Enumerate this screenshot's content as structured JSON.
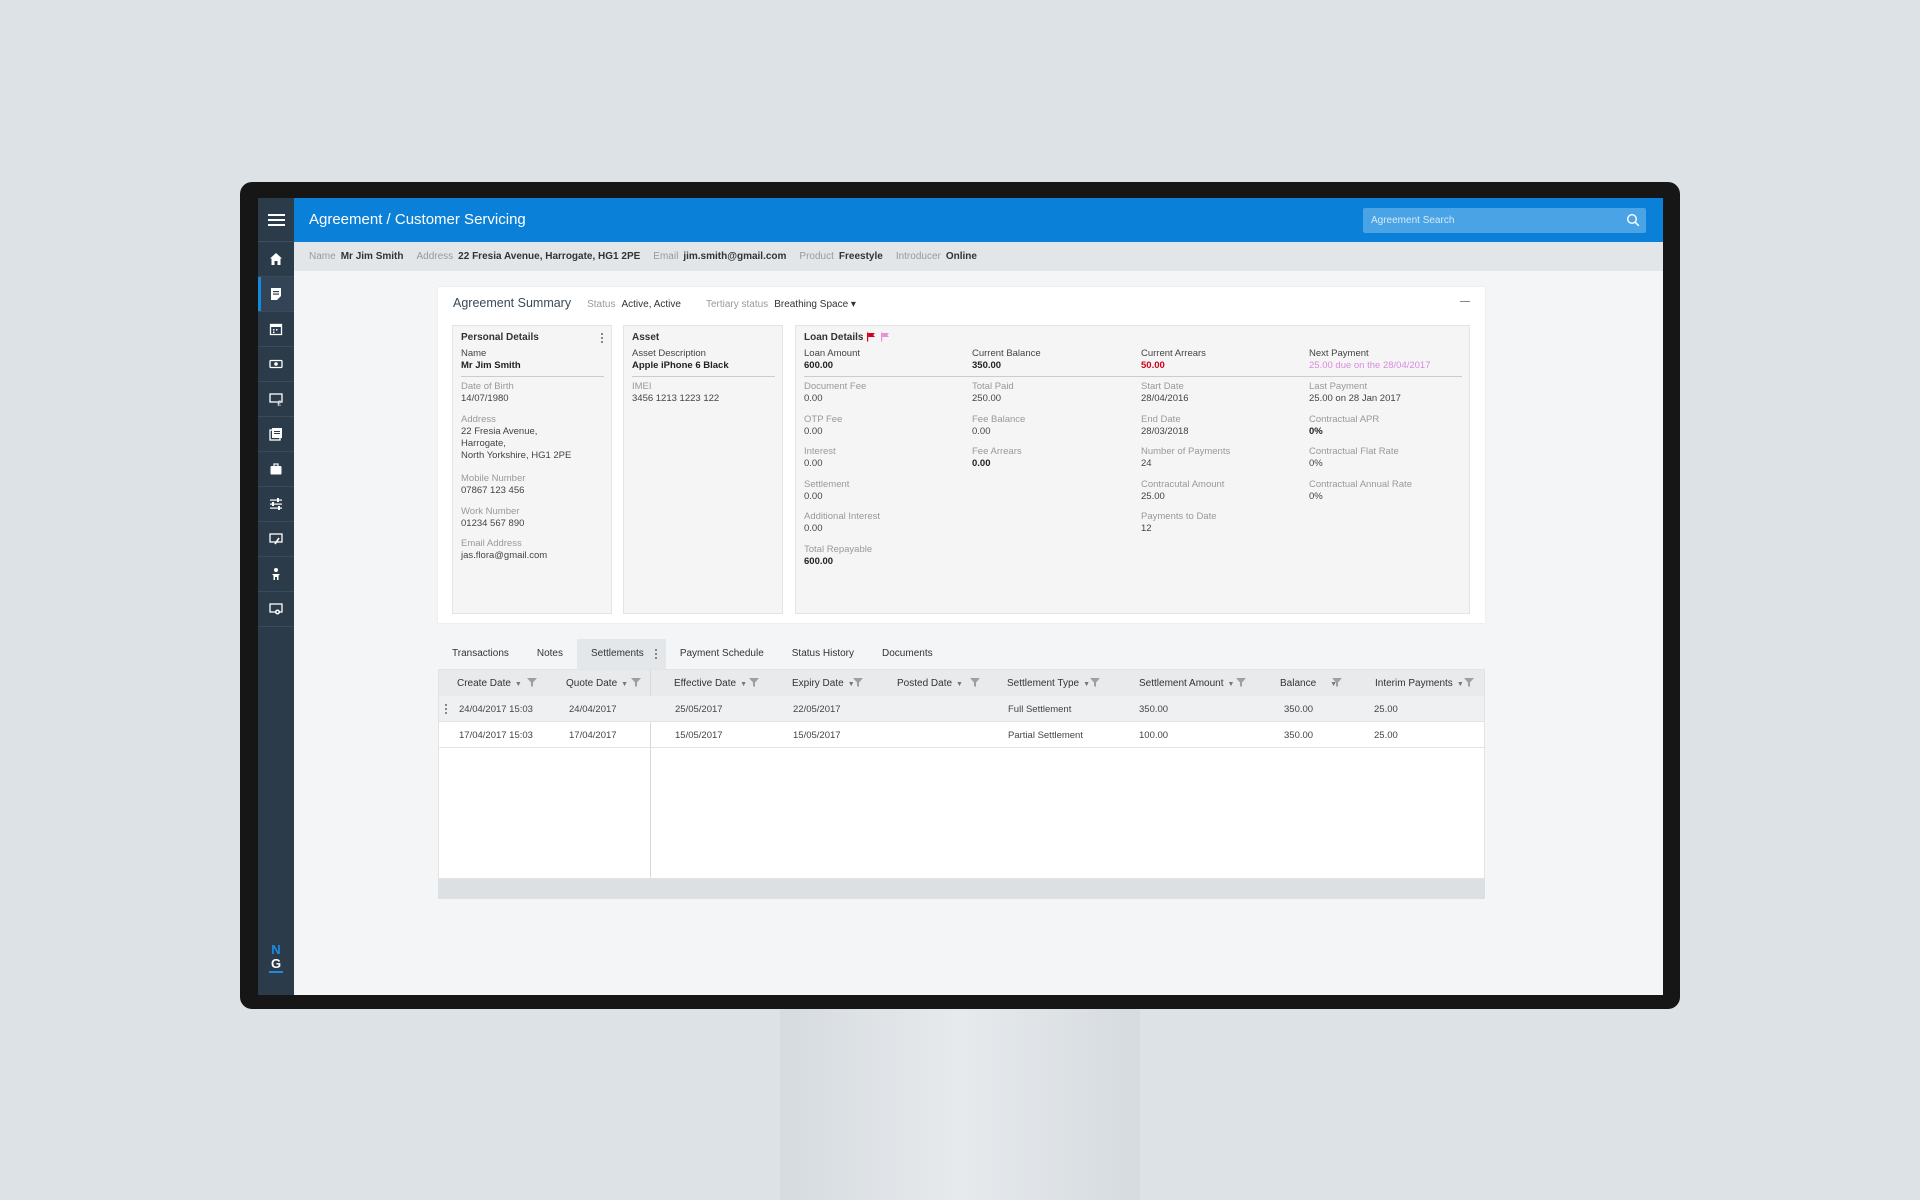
{
  "app": {
    "title": "Agreement / Customer Servicing"
  },
  "search": {
    "placeholder": "Agreement Search"
  },
  "infobar": {
    "name_label": "Name",
    "name": "Mr Jim Smith",
    "address_label": "Address",
    "address": "22 Fresia Avenue, Harrogate, HG1 2PE",
    "email_label": "Email",
    "email": "jim.smith@gmail.com",
    "product_label": "Product",
    "product": "Freestyle",
    "introducer_label": "Introducer",
    "introducer": "Online"
  },
  "summary": {
    "title": "Agreement Summary",
    "status_label": "Status",
    "status": "Active, Active",
    "tertiary_label": "Tertiary status",
    "tertiary": "Breathing Space ▾"
  },
  "personal": {
    "title": "Personal Details",
    "name_label": "Name",
    "name": "Mr Jim Smith",
    "dob_label": "Date of Birth",
    "dob": "14/07/1980",
    "address_label": "Address",
    "address1": "22 Fresia Avenue,",
    "address2": "Harrogate,",
    "address3": "North Yorkshire, HG1 2PE",
    "mobile_label": "Mobile Number",
    "mobile": "07867 123 456",
    "work_label": "Work Number",
    "work": "01234 567 890",
    "email_label": "Email Address",
    "email": "jas.flora@gmail.com"
  },
  "asset": {
    "title": "Asset",
    "desc_label": "Asset Description",
    "desc": "Apple iPhone 6 Black",
    "imei_label": "IMEI",
    "imei": "3456 1213 1223 122"
  },
  "loan": {
    "title": "Loan Details",
    "loan_amount_label": "Loan Amount",
    "loan_amount": "600.00",
    "current_balance_label": "Current Balance",
    "current_balance": "350.00",
    "current_arrears_label": "Current Arrears",
    "current_arrears": "50.00",
    "next_payment_label": "Next Payment",
    "next_payment": "25.00 due on the 28/04/2017",
    "document_fee_label": "Document Fee",
    "document_fee": "0.00",
    "total_paid_label": "Total Paid",
    "total_paid": "250.00",
    "start_date_label": "Start Date",
    "start_date": "28/04/2016",
    "last_payment_label": "Last Payment",
    "last_payment": "25.00 on 28 Jan 2017",
    "otp_fee_label": "OTP Fee",
    "otp_fee": "0.00",
    "fee_balance_label": "Fee Balance",
    "fee_balance": "0.00",
    "end_date_label": "End Date",
    "end_date": "28/03/2018",
    "contractual_apr_label": "Contractual APR",
    "contractual_apr": "0%",
    "interest_label": "Interest",
    "interest": "0.00",
    "fee_arrears_label": "Fee Arrears",
    "fee_arrears": "0.00",
    "num_payments_label": "Number of Payments",
    "num_payments": "24",
    "flat_rate_label": "Contractual Flat Rate",
    "flat_rate": "0%",
    "settlement_label": "Settlement",
    "settlement": "0.00",
    "contractual_amount_label": "Contracutal Amount",
    "contractual_amount": "25.00",
    "annual_rate_label": "Contractual Annual Rate",
    "annual_rate": "0%",
    "additional_interest_label": "Additional Interest",
    "additional_interest": "0.00",
    "payments_to_date_label": "Payments to Date",
    "payments_to_date": "12",
    "total_repayable_label": "Total Repayable",
    "total_repayable": "600.00",
    "flag_colors": [
      "#d0021b",
      "#e88fd6"
    ]
  },
  "tabs": [
    "Transactions",
    "Notes",
    "Settlements",
    "Payment Schedule",
    "Status History",
    "Documents"
  ],
  "grid": {
    "columns": [
      "Create Date",
      "Quote Date",
      "Effective Date",
      "Expiry Date",
      "Posted Date",
      "Settlement Type",
      "Settlement Amount",
      "Balance",
      "Interim Payments"
    ],
    "rows": [
      [
        "24/04/2017  15:03",
        "24/04/2017",
        "25/05/2017",
        "22/05/2017",
        "",
        "Full Settlement",
        "350.00",
        "350.00",
        "25.00"
      ],
      [
        "17/04/2017  15:03",
        "17/04/2017",
        "15/05/2017",
        "15/05/2017",
        "",
        "Partial Settlement",
        "100.00",
        "350.00",
        "25.00"
      ]
    ]
  },
  "colors": {
    "brand": "#0a80d8",
    "rail": "#2b3b4a",
    "arrears": "#d0021b",
    "next_payment": "#d98be0"
  }
}
